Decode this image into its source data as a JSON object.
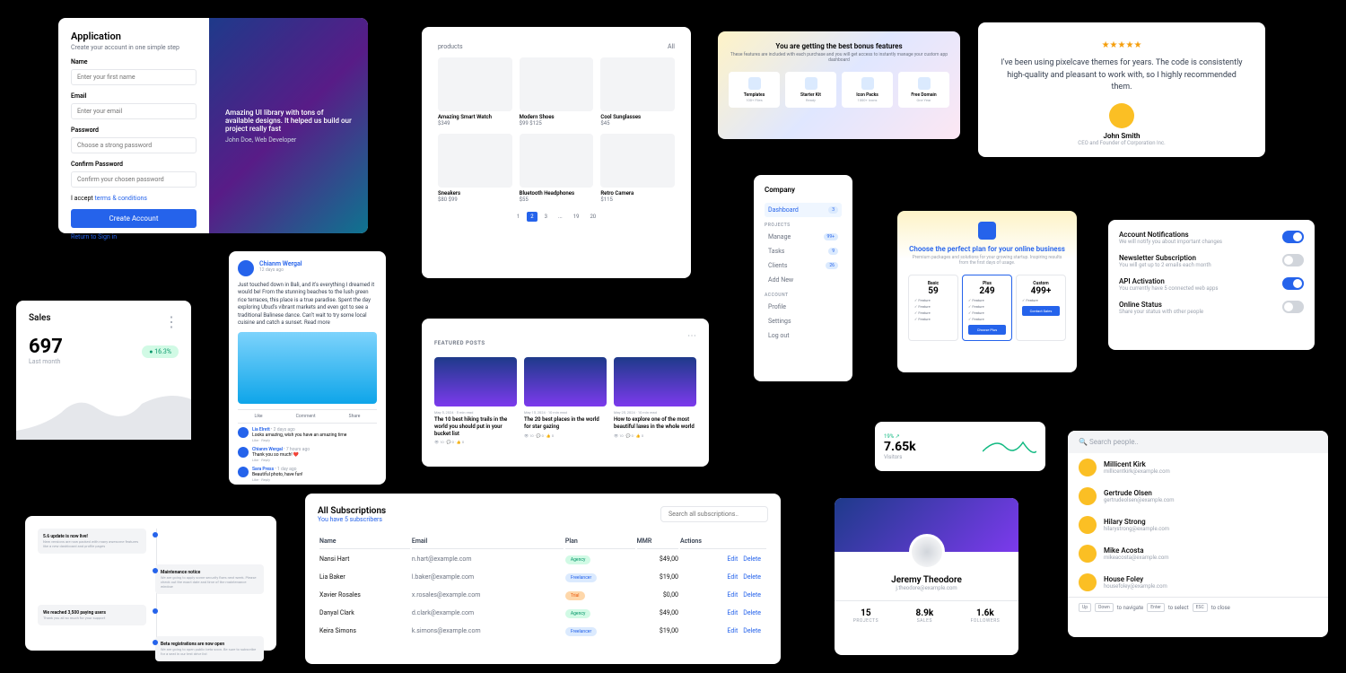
{
  "signup": {
    "title": "Application",
    "subtitle": "Create your account in one simple step",
    "name_label": "Name",
    "name_placeholder": "Enter your first name",
    "email_label": "Email",
    "email_placeholder": "Enter your email",
    "password_label": "Password",
    "password_placeholder": "Choose a strong password",
    "confirm_label": "Confirm Password",
    "confirm_placeholder": "Confirm your chosen password",
    "accept_prefix": "I accept ",
    "accept_link": "terms & conditions",
    "submit": "Create Account",
    "return": "Return to Sign in",
    "quote": "Amazing UI library with tons of available designs. It helped us build our project really fast",
    "author": "John Doe, Web Developer"
  },
  "products": {
    "crumb": "products",
    "sort": "All",
    "items": [
      {
        "name": "Amazing Smart Watch",
        "price": "$349"
      },
      {
        "name": "Modern Shoes",
        "price": "$99 $125"
      },
      {
        "name": "Cool Sunglasses",
        "price": "$45"
      },
      {
        "name": "Sneakers",
        "price": "$80 $99"
      },
      {
        "name": "Bluetooth Headphones",
        "price": "$55"
      },
      {
        "name": "Retro Camera",
        "price": "$115"
      }
    ],
    "pages": [
      "1",
      "2",
      "3",
      "...",
      "19",
      "20"
    ]
  },
  "bonus": {
    "title": "You are getting the best bonus features",
    "subtitle": "These features are included with each purchase and you will get access to instantly manage your custom app dashboard",
    "items": [
      {
        "title": "Templates",
        "sub": "100+ Files"
      },
      {
        "title": "Starter Kit",
        "sub": "Ready"
      },
      {
        "title": "Icon Packs",
        "sub": "1000+ Icons"
      },
      {
        "title": "Free Domain",
        "sub": "One Year"
      }
    ]
  },
  "testimonial": {
    "quote": "I've been using pixelcave themes for years. The code is consistently high-quality and pleasant to work with, so I highly recommended them.",
    "name": "John Smith",
    "role": "CEO and Founder of Corporation Inc."
  },
  "sidebar": {
    "brand": "Company",
    "items": [
      {
        "label": "Dashboard",
        "badge": "3"
      },
      {
        "section": "PROJECTS"
      },
      {
        "label": "Manage",
        "badge": "99+"
      },
      {
        "label": "Tasks",
        "badge": "9"
      },
      {
        "label": "Clients",
        "badge": "26"
      },
      {
        "label": "Add New"
      },
      {
        "section": "ACCOUNT"
      },
      {
        "label": "Profile"
      },
      {
        "label": "Settings"
      },
      {
        "label": "Log out"
      }
    ]
  },
  "pricing": {
    "heading_pre": "Choose the perfect plan for your ",
    "heading_em": "online business",
    "sub": "Premium packages and solutions for your growing startup. Inspiring results from the first days of usage.",
    "plans": [
      {
        "name": "Basic",
        "price": "59",
        "features": [
          "Feature",
          "Feature",
          "Feature",
          "Feature"
        ]
      },
      {
        "name": "Plus",
        "price": "249",
        "features": [
          "Feature",
          "Feature",
          "Feature",
          "Feature"
        ],
        "cta": "Choose Plus"
      },
      {
        "name": "Custom",
        "price": "499+",
        "features": [
          "Feature"
        ],
        "cta": "Contact Sales"
      }
    ]
  },
  "toggles": [
    {
      "title": "Account Notifications",
      "sub": "We will notify you about important changes",
      "on": true
    },
    {
      "title": "Newsletter Subscription",
      "sub": "You will get up to 2 emails each month",
      "on": false
    },
    {
      "title": "API Activation",
      "sub": "You currently have 5 connected web apps",
      "on": true
    },
    {
      "title": "Online Status",
      "sub": "Share your status with other people",
      "on": false
    }
  ],
  "sales": {
    "title": "Sales",
    "value": "697",
    "label": "Last month",
    "badge": "16.3%"
  },
  "social": {
    "author": "Chianm Wergal",
    "time": "12 days ago",
    "text": "Just touched down in Bali, and it's everything I dreamed it would be! From the stunning beaches to the lush green rice terraces, this place is a true paradise. Spent the day exploring Ubud's vibrant markets and even got to see a traditional Balinese dance. Can't wait to try some local cuisine and catch a sunset. Read more",
    "actions": [
      "Like",
      "Comment",
      "Share"
    ],
    "comments": [
      {
        "name": "Lia Elrett",
        "time": "2 days ago",
        "text": "Looks amazing, wish you have an amazing time",
        "links": "Like · Reply"
      },
      {
        "name": "Chianm Wergal",
        "time": "7 hours ago",
        "text": "Thank you so much! ❤️",
        "links": "Like · Reply"
      },
      {
        "name": "Sara Press",
        "time": "1 day ago",
        "text": "Beautiful photo, have fun!",
        "links": "Like · Reply"
      }
    ]
  },
  "featured": {
    "section": "FEATURED POSTS",
    "items": [
      {
        "date": "May 5, 2024 · 5 min read",
        "title": "The 10 best hiking trails in the world you should put in your bucket list",
        "meta": "👁 10 · 💬 0 · 👍 0"
      },
      {
        "date": "May 15, 2024 · 10 min read",
        "title": "The 20 best places in the world for star gazing",
        "meta": "👁 10 · 💬 0 · 👍 0"
      },
      {
        "date": "May 25, 2024 · 10 min read",
        "title": "How to explore one of the most beautiful laxes in the whole world",
        "meta": "👁 10 · 💬 0 · 👍 0"
      }
    ]
  },
  "visitors": {
    "pct": "19% ↗",
    "value": "7.65k",
    "label": "Visitors"
  },
  "people": {
    "placeholder": "Search people..",
    "rows": [
      {
        "name": "Millicent Kirk",
        "email": "millicentkirk@example.com"
      },
      {
        "name": "Gertrude Olsen",
        "email": "gertrudeolsen@example.com"
      },
      {
        "name": "Hilary Strong",
        "email": "hilarystrong@example.com"
      },
      {
        "name": "Mike Acosta",
        "email": "mikeacosta@example.com"
      },
      {
        "name": "House Foley",
        "email": "housefoley@example.com"
      }
    ],
    "footer": {
      "up": "Up",
      "down": "Down",
      "nav": "to navigate",
      "enter": "Enter",
      "sel": "to select",
      "esc": "ESC",
      "close": "to close"
    }
  },
  "timeline": [
    {
      "side": "left",
      "title": "5.6 update is now live!",
      "sub": "New versions are now packed with many awesome features like a new dashboard and profile pages"
    },
    {
      "side": "right",
      "title": "Maintenance notice",
      "sub": "We are going to apply some security fixes next week. Please check out the exact date and time of the maintenance window"
    },
    {
      "side": "left",
      "title": "We reached 3,500 paying users",
      "sub": "Thank you all so much for your support"
    },
    {
      "side": "right",
      "title": "Beta registrations are now open",
      "sub": "We are going to open public beta soon. Be sure to subscribe for a seat in our test drive list"
    }
  ],
  "subs": {
    "title": "All Subscriptions",
    "sub_pre": "You have ",
    "sub_em": "5 subscribers",
    "search_placeholder": "Search all subscriptions..",
    "headers": [
      "Name",
      "Email",
      "Plan",
      "MMR",
      "Actions"
    ],
    "rows": [
      {
        "name": "Nansi Hart",
        "email": "n.hart@example.com",
        "plan": "Agency",
        "planClass": "agency",
        "mmr": "$49,00"
      },
      {
        "name": "Lia Baker",
        "email": "l.baker@example.com",
        "plan": "Freelancer",
        "planClass": "freelancer",
        "mmr": "$19,00"
      },
      {
        "name": "Xavier Rosales",
        "email": "x.rosales@example.com",
        "plan": "Trial",
        "planClass": "trial",
        "mmr": "$0,00"
      },
      {
        "name": "Danyal Clark",
        "email": "d.clark@example.com",
        "plan": "Agency",
        "planClass": "agency",
        "mmr": "$49,00"
      },
      {
        "name": "Keira Simons",
        "email": "k.simons@example.com",
        "plan": "Freelancer",
        "planClass": "freelancer",
        "mmr": "$19,00"
      }
    ],
    "edit": "Edit",
    "delete": "Delete"
  },
  "profile": {
    "name": "Jeremy Theodore",
    "email": "j.theodore@example.com",
    "stats": [
      {
        "n": "15",
        "l": "PROJECTS"
      },
      {
        "n": "8.9k",
        "l": "SALES"
      },
      {
        "n": "1.6k",
        "l": "FOLLOWERS"
      }
    ]
  }
}
